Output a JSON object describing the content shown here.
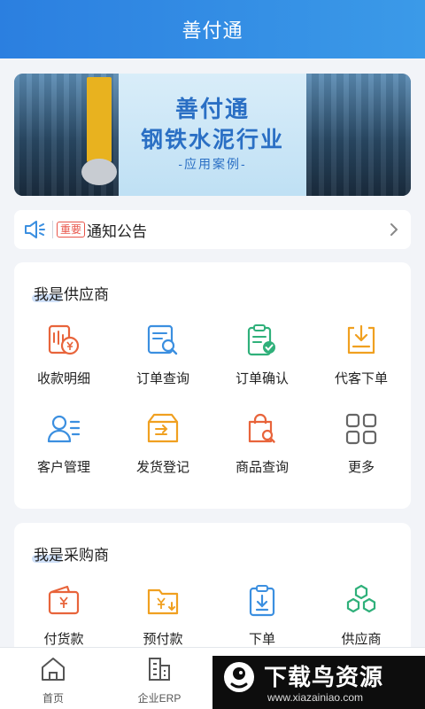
{
  "header": {
    "title": "善付通"
  },
  "banner": {
    "brand": "善付通",
    "headline": "钢铁水泥行业",
    "subtitle": "-应用案例-"
  },
  "notice": {
    "badge": "重要",
    "text": "通知公告",
    "icon": "speaker-icon"
  },
  "supplier": {
    "title": "我是供应商",
    "items": [
      {
        "label": "收款明细",
        "icon": "receipt-icon",
        "color": "#e8643b"
      },
      {
        "label": "订单查询",
        "icon": "order-search-icon",
        "color": "#3b8fe0"
      },
      {
        "label": "订单确认",
        "icon": "order-confirm-icon",
        "color": "#2fb07a"
      },
      {
        "label": "代客下单",
        "icon": "download-order-icon",
        "color": "#f0a020"
      },
      {
        "label": "客户管理",
        "icon": "customer-icon",
        "color": "#3b8fe0"
      },
      {
        "label": "发货登记",
        "icon": "shipping-box-icon",
        "color": "#f0a020"
      },
      {
        "label": "商品查询",
        "icon": "shopping-bag-icon",
        "color": "#e8643b"
      },
      {
        "label": "更多",
        "icon": "more-grid-icon",
        "color": "#666666"
      }
    ]
  },
  "buyer": {
    "title": "我是采购商",
    "items": [
      {
        "label": "付货款",
        "icon": "wallet-icon",
        "color": "#e8643b"
      },
      {
        "label": "预付款",
        "icon": "prepay-icon",
        "color": "#f0a020"
      },
      {
        "label": "下单",
        "icon": "clipboard-download-icon",
        "color": "#3b8fe0"
      },
      {
        "label": "供应商",
        "icon": "hexagons-icon",
        "color": "#2fb07a"
      }
    ]
  },
  "tabbar": {
    "tabs": [
      {
        "label": "首页",
        "icon": "home-icon"
      },
      {
        "label": "企业ERP",
        "icon": "building-icon"
      }
    ]
  },
  "watermark": {
    "title": "下载鸟资源",
    "url": "www.xiazainiao.com"
  }
}
